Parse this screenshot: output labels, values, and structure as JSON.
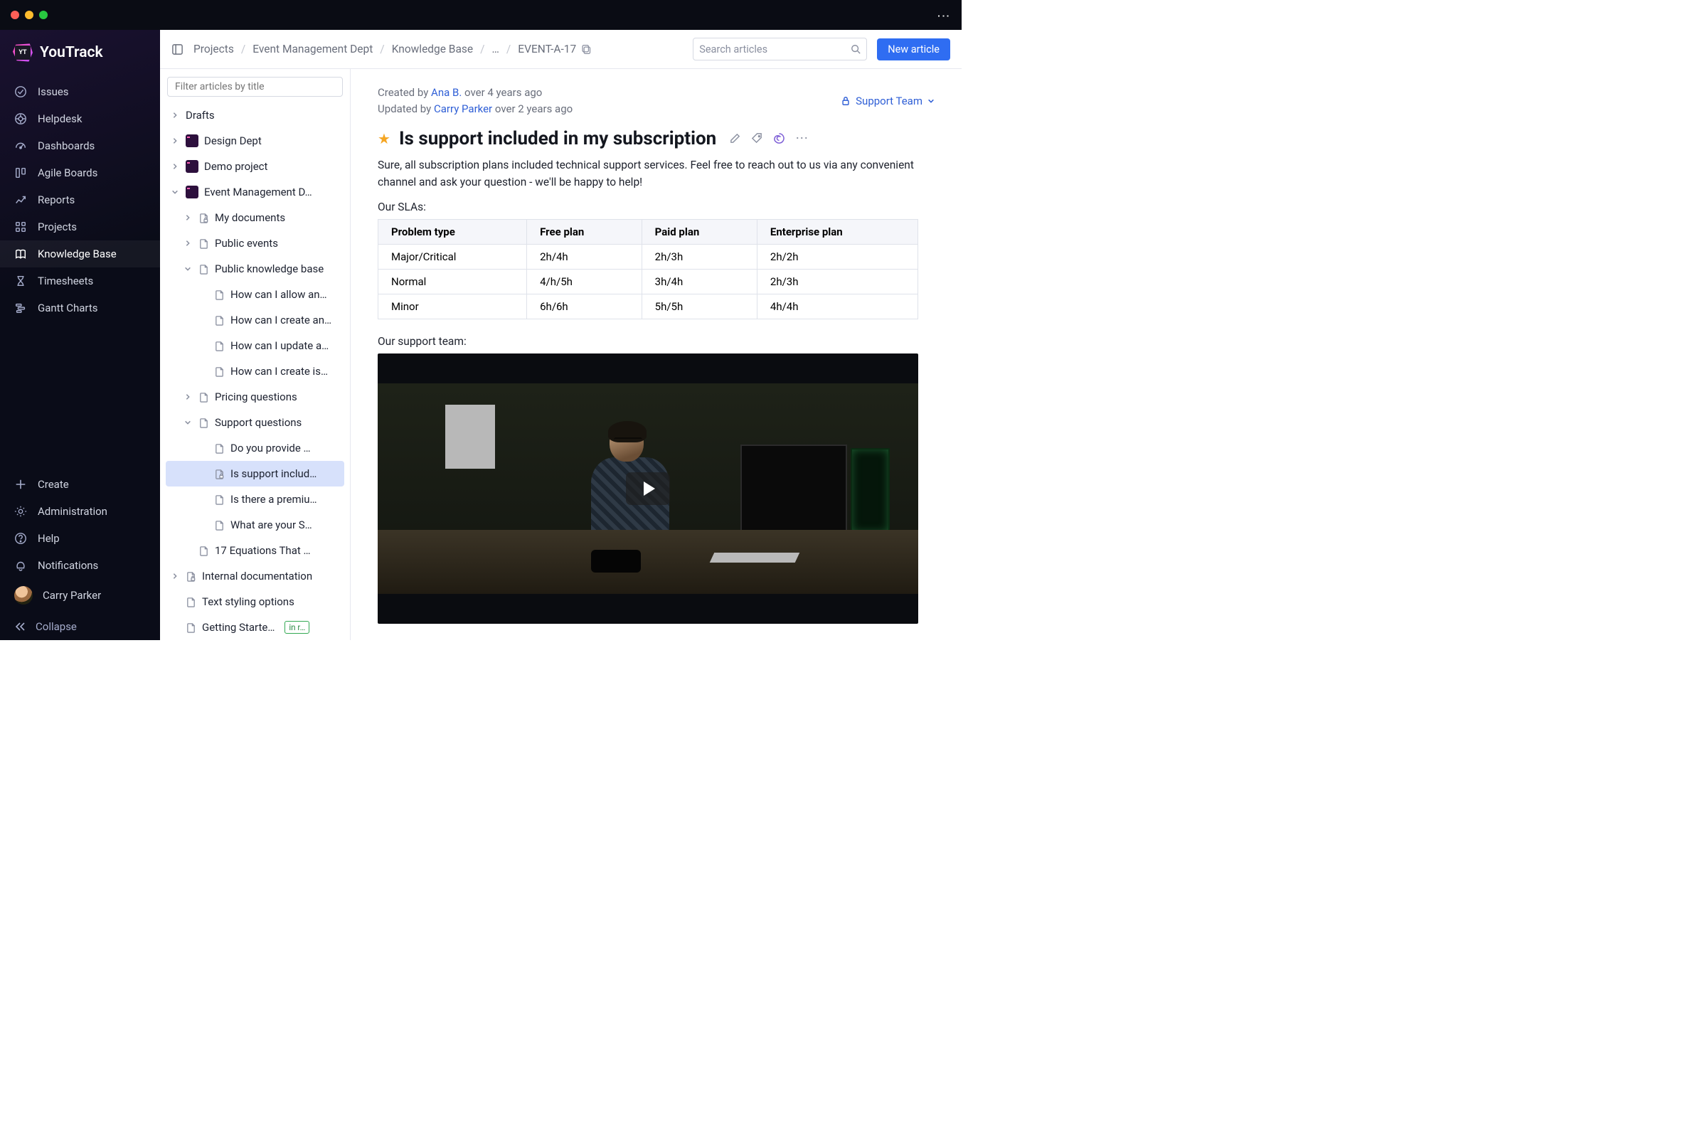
{
  "app": {
    "name": "YouTrack",
    "logo_badge": "YT"
  },
  "window": {
    "more_menu": "⋯"
  },
  "sidebar": {
    "nav": [
      {
        "label": "Issues",
        "icon": "check-circle-icon"
      },
      {
        "label": "Helpdesk",
        "icon": "lifebuoy-icon"
      },
      {
        "label": "Dashboards",
        "icon": "gauge-icon"
      },
      {
        "label": "Agile Boards",
        "icon": "boards-icon"
      },
      {
        "label": "Reports",
        "icon": "reports-icon"
      },
      {
        "label": "Projects",
        "icon": "grid-icon"
      },
      {
        "label": "Knowledge Base",
        "icon": "book-icon",
        "active": true
      },
      {
        "label": "Timesheets",
        "icon": "hourglass-icon"
      },
      {
        "label": "Gantt Charts",
        "icon": "gantt-icon"
      }
    ],
    "footer": [
      {
        "label": "Create",
        "icon": "plus-icon"
      },
      {
        "label": "Administration",
        "icon": "gear-icon"
      },
      {
        "label": "Help",
        "icon": "help-icon"
      },
      {
        "label": "Notifications",
        "icon": "bell-icon"
      }
    ],
    "user": "Carry Parker",
    "collapse": "Collapse"
  },
  "topbar": {
    "breadcrumbs": [
      "Projects",
      "Event Management Dept",
      "Knowledge Base",
      "…",
      "EVENT-A-17"
    ],
    "search_placeholder": "Search articles",
    "new_article": "New article"
  },
  "tree": {
    "filter_placeholder": "Filter articles by title",
    "rows": [
      {
        "depth": 0,
        "chev": "right",
        "icon": "none",
        "label": "Drafts"
      },
      {
        "depth": 0,
        "chev": "right",
        "icon": "project",
        "label": "Design Dept"
      },
      {
        "depth": 0,
        "chev": "right",
        "icon": "project",
        "label": "Demo project"
      },
      {
        "depth": 0,
        "chev": "down",
        "icon": "project",
        "label": "Event Management D…"
      },
      {
        "depth": 1,
        "chev": "right",
        "icon": "doc-lock",
        "label": "My documents"
      },
      {
        "depth": 1,
        "chev": "right",
        "icon": "doc",
        "label": "Public events"
      },
      {
        "depth": 1,
        "chev": "down",
        "icon": "doc",
        "label": "Public knowledge base"
      },
      {
        "depth": 2,
        "chev": "",
        "icon": "doc",
        "label": "How can I allow an…"
      },
      {
        "depth": 2,
        "chev": "",
        "icon": "doc",
        "label": "How can I create an…"
      },
      {
        "depth": 2,
        "chev": "",
        "icon": "doc",
        "label": "How can I update a…"
      },
      {
        "depth": 2,
        "chev": "",
        "icon": "doc",
        "label": "How can I create is…"
      },
      {
        "depth": 1,
        "chev": "right",
        "icon": "doc",
        "label": "Pricing questions"
      },
      {
        "depth": 1,
        "chev": "down",
        "icon": "doc",
        "label": "Support questions"
      },
      {
        "depth": 2,
        "chev": "",
        "icon": "doc",
        "label": "Do you provide …"
      },
      {
        "depth": 2,
        "chev": "",
        "icon": "doc-lock",
        "label": "Is support includ…",
        "selected": true
      },
      {
        "depth": 2,
        "chev": "",
        "icon": "doc",
        "label": "Is there a premiu…"
      },
      {
        "depth": 2,
        "chev": "",
        "icon": "doc",
        "label": "What are your S…"
      },
      {
        "depth": 1,
        "chev": "",
        "icon": "doc",
        "label": "17 Equations That …"
      },
      {
        "depth": 0,
        "chev": "right",
        "icon": "doc-lock",
        "label": "Internal documentation"
      },
      {
        "depth": 0,
        "chev": "",
        "icon": "doc",
        "label": "Text styling options"
      },
      {
        "depth": 0,
        "chev": "",
        "icon": "doc",
        "label": "Getting Starte…",
        "badge": "in r…"
      }
    ]
  },
  "article": {
    "created_prefix": "Created by ",
    "created_by": "Ana B.",
    "created_ago": "over 4 years ago",
    "updated_prefix": "Updated by ",
    "updated_by": "Carry Parker",
    "updated_ago": "over 2 years ago",
    "visibility": "Support Team",
    "title": "Is support included in my subscription",
    "body": "Sure, all subscription plans included technical support services. Feel free to reach out to us via any convenient channel and ask your question - we'll be happy to help!",
    "sla_heading": "Our SLAs:",
    "sla_table": {
      "headers": [
        "Problem type",
        "Free plan",
        "Paid plan",
        "Enterprise plan"
      ],
      "rows": [
        [
          "Major/Critical",
          "2h/4h",
          "2h/3h",
          "2h/2h"
        ],
        [
          "Normal",
          "4/h/5h",
          "3h/4h",
          "2h/3h"
        ],
        [
          "Minor",
          "6h/6h",
          "5h/5h",
          "4h/4h"
        ]
      ]
    },
    "team_heading": "Our support team:"
  }
}
